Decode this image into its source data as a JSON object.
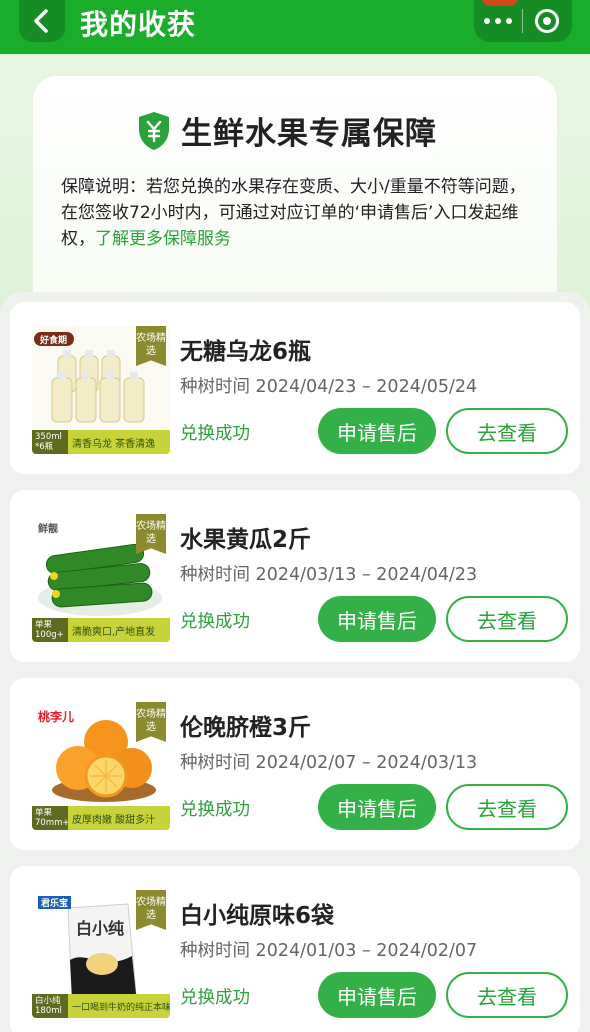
{
  "header": {
    "title": "我的收获",
    "back_icon": "chevron-left-icon",
    "more_icon": "more-dots-icon",
    "close_icon": "target-close-icon",
    "bg_color": "#1aad2c"
  },
  "guarantee": {
    "title": "生鲜水果专属保障",
    "icon": "shield-yen-icon",
    "desc_text": "保障说明：若您兑换的水果存在变质、大小/重量不符等问题，在您签收72小时内，可通过对应订单的‘申请售后’入口发起维权，",
    "link_text": "了解更多保障服务"
  },
  "orders": [
    {
      "name": "无糖乌龙6瓶",
      "time": "种树时间 2024/04/23 – 2024/05/24",
      "status": "兑换成功",
      "after_sale_label": "申请售后",
      "view_label": "去查看",
      "thumb": {
        "brand": "好食期",
        "tag": "农场精选",
        "spec": "350ml *6瓶",
        "slogan": "清香乌龙 茶香清逸"
      }
    },
    {
      "name": "水果黄瓜2斤",
      "time": "种树时间 2024/03/13 – 2024/04/23",
      "status": "兑换成功",
      "after_sale_label": "申请售后",
      "view_label": "去查看",
      "thumb": {
        "brand": "鲜靓",
        "tag": "农场精选",
        "spec": "单果 100g+",
        "slogan": "清脆爽口,产地直发"
      }
    },
    {
      "name": "伦晚脐橙3斤",
      "time": "种树时间 2024/02/07 – 2024/03/13",
      "status": "兑换成功",
      "after_sale_label": "申请售后",
      "view_label": "去查看",
      "thumb": {
        "brand": "桃李儿",
        "tag": "农场精选",
        "spec": "单果 70mm+",
        "slogan": "皮厚肉嫩 酸甜多汁"
      }
    },
    {
      "name": "白小纯原味6袋",
      "time": "种树时间 2024/01/03 – 2024/02/07",
      "status": "兑换成功",
      "after_sale_label": "申请售后",
      "view_label": "去查看",
      "thumb": {
        "brand": "君乐宝",
        "tag": "农场精选",
        "spec": "白小纯 180ml",
        "slogan": "一口喝到牛奶的纯正本味"
      }
    }
  ]
}
